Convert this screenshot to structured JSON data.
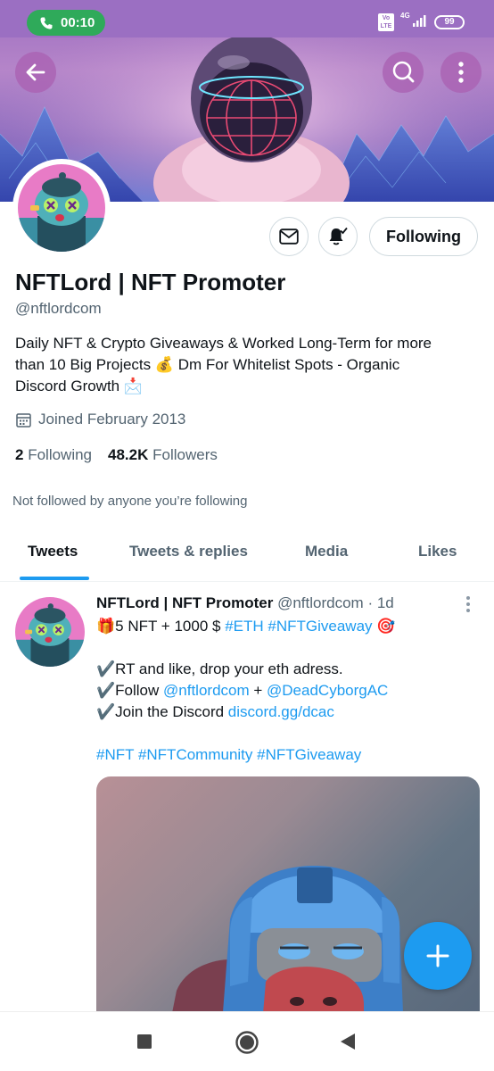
{
  "status_bar": {
    "call_timer": "00:10",
    "volte_label": "Vo LTE",
    "network": "4G",
    "battery": "99"
  },
  "icons": {
    "back": "back-arrow-icon",
    "search": "search-icon",
    "more": "more-vertical-icon",
    "message": "mail-icon",
    "notifications": "bell-icon",
    "calendar": "calendar-icon",
    "compose": "plus-icon"
  },
  "profile": {
    "name": "NFTLord | NFT Promoter",
    "handle": "@nftlordcom",
    "bio_line1": "Daily NFT & Crypto Giveaways & Worked Long-Term for more",
    "bio_line2": "than 10 Big Projects 💰 Dm For Whitelist Spots - Organic",
    "bio_line3": "Discord Growth 📩",
    "joined": "Joined February 2013",
    "following_count": "2",
    "following_label": "Following",
    "followers_count": "48.2K",
    "followers_label": "Followers",
    "not_followed": "Not followed by anyone you’re following",
    "follow_button": "Following"
  },
  "tabs": [
    {
      "label": "Tweets",
      "active": true
    },
    {
      "label": "Tweets & replies",
      "active": false
    },
    {
      "label": "Media",
      "active": false
    },
    {
      "label": "Likes",
      "active": false
    }
  ],
  "tweet": {
    "author_name": "NFTLord | NFT Promoter",
    "author_handle": "@nftlordcom",
    "time": "· 1d",
    "l1_text": "🎁5 NFT + 1000 $ ",
    "l1_tag1": "#ETH",
    "l1_tag2": "#NFTGiveaway",
    "l1_end": " 🎯",
    "l2": "✔️RT and like, drop your eth adress.",
    "l3_text": "✔️Follow ",
    "l3_m1": "@nftlordcom",
    "l3_plus": " + ",
    "l3_m2": "@DeadCyborgAC",
    "l4_text": "✔️Join the Discord ",
    "l4_link": "discord.gg/dcac",
    "l5_t1": "#NFT",
    "l5_t2": "#NFTCommunity",
    "l5_t3": "#NFTGiveaway"
  },
  "colors": {
    "accent": "#1d9bf0",
    "banner": "#9b6fc2",
    "call": "#2faa5a",
    "text": "#0f1419",
    "muted": "#536471"
  }
}
